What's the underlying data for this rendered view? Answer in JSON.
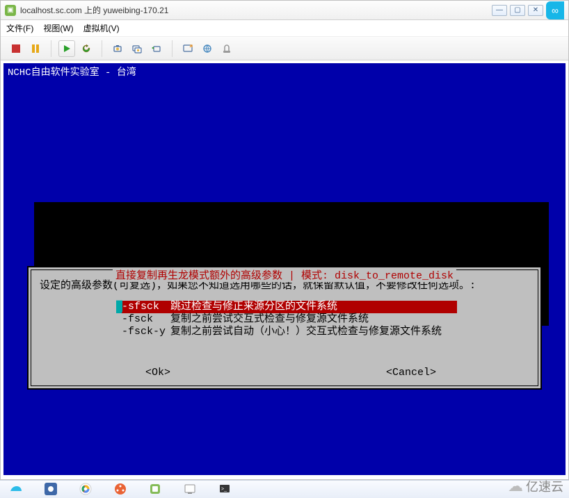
{
  "titlebar": {
    "text": "localhost.sc.com 上的 yuweibing-170.21"
  },
  "menubar": {
    "file": "文件(F)",
    "view": "视图(W)",
    "vm": "虚拟机(V)"
  },
  "toolbar": {
    "icons": {
      "stop": "stop-icon",
      "pause": "pause-icon",
      "play": "play-icon",
      "restart": "restart-icon",
      "snapshot": "snapshot-icon",
      "snapshot_mgr": "snapshot-manager-icon",
      "revert": "revert-icon",
      "fullscreen": "fullscreen-icon",
      "unity": "unity-icon",
      "devices": "devices-icon"
    }
  },
  "vm": {
    "header": "NCHC自由软件实验室  -  台湾"
  },
  "dialog": {
    "title": "直接复制再生龙模式额外的高级参数 | 模式: disk_to_remote_disk",
    "prompt": "设定的高级参数(可复选)，如果您不知道选用哪些的话，就保留默认值，不要修改任何选项。:",
    "options": [
      {
        "flag": "-sfsck",
        "desc": "跳过检查与修正来源分区的文件系统",
        "selected": true
      },
      {
        "flag": "-fsck",
        "desc": "复制之前尝试交互式检查与修复源文件系统",
        "selected": false
      },
      {
        "flag": "-fsck-y",
        "desc": "复制之前尝试自动（小心！）交互式检查与修复源文件系统",
        "selected": false
      }
    ],
    "ok": "<Ok>",
    "cancel": "<Cancel>"
  },
  "watermark": {
    "text": "亿速云"
  }
}
